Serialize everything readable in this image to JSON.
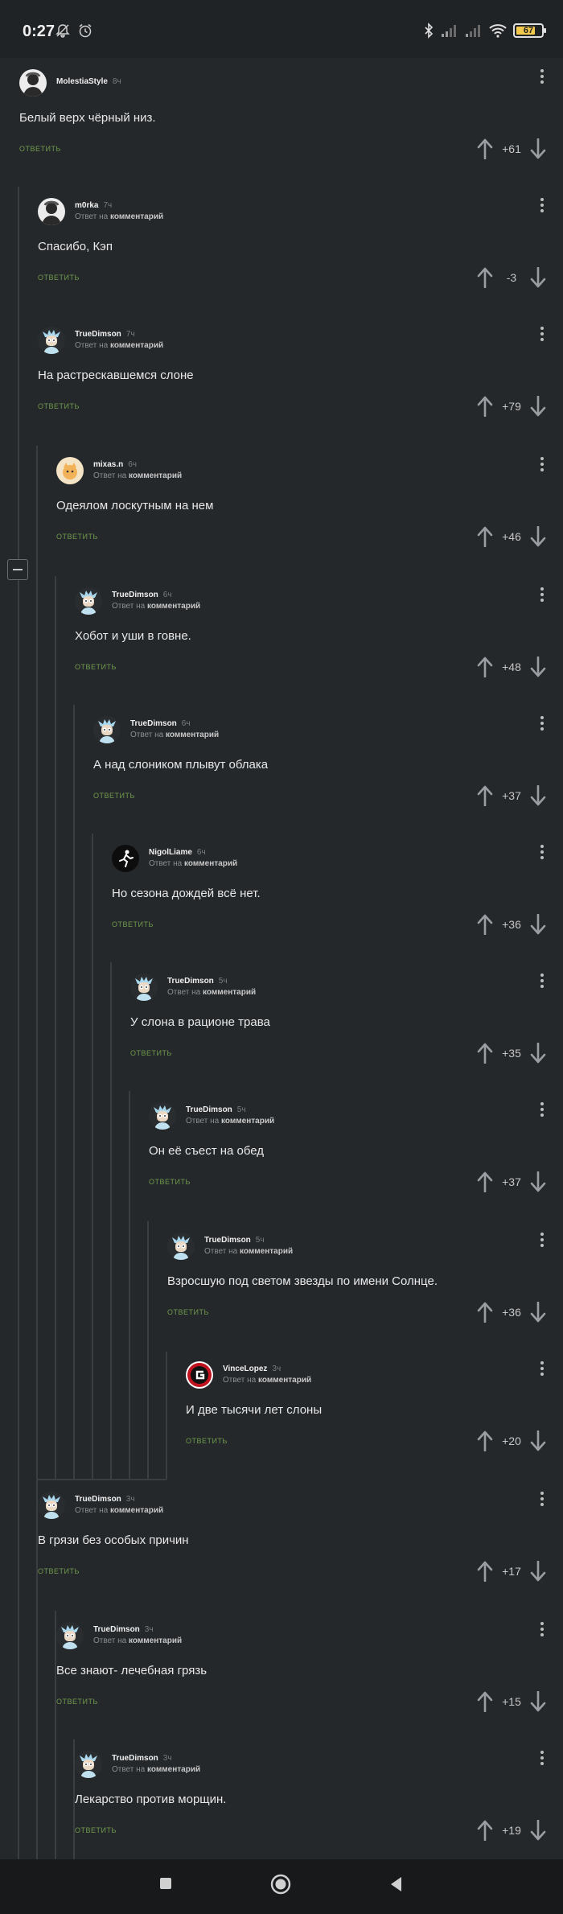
{
  "status_bar": {
    "time": "0:27",
    "battery": "67",
    "battery_color": "#f2c94c"
  },
  "comments": [
    {
      "author": "MolestiaStyle",
      "time": "8ч",
      "reply_to": "",
      "text": "Белый верх чёрный низ.",
      "score": "+61",
      "avatar": "user-avatar"
    },
    {
      "author": "m0rka",
      "time": "7ч",
      "reply_to": "комментарий",
      "text": "Спасибо, Кэп",
      "score": "-3",
      "avatar": "user-avatar"
    },
    {
      "author": "TrueDimson",
      "time": "7ч",
      "reply_to": "комментарий",
      "text": "На растрескавшемся слоне",
      "score": "+79",
      "avatar": "rick-avatar"
    },
    {
      "author": "mixas.n",
      "time": "6ч",
      "reply_to": "комментарий",
      "text": "Одеялом лоскутным на нем",
      "score": "+46",
      "avatar": "cat-avatar"
    },
    {
      "author": "TrueDimson",
      "time": "6ч",
      "reply_to": "комментарий",
      "text": "Хобот и уши в говне.",
      "score": "+48",
      "avatar": "rick-avatar"
    },
    {
      "author": "TrueDimson",
      "time": "6ч",
      "reply_to": "комментарий",
      "text": "А над слоником плывут облака",
      "score": "+37",
      "avatar": "rick-avatar"
    },
    {
      "author": "NigolLiame",
      "time": "6ч",
      "reply_to": "комментарий",
      "text": "Но сезона дождей всё нет.",
      "score": "+36",
      "avatar": "runner-avatar"
    },
    {
      "author": "TrueDimson",
      "time": "5ч",
      "reply_to": "комментарий",
      "text": "У слона в рационе трава",
      "score": "+35",
      "avatar": "rick-avatar"
    },
    {
      "author": "TrueDimson",
      "time": "5ч",
      "reply_to": "комментарий",
      "text": "Он её съест на обед",
      "score": "+37",
      "avatar": "rick-avatar"
    },
    {
      "author": "TrueDimson",
      "time": "5ч",
      "reply_to": "комментарий",
      "text": "Взросшую под светом звезды по имени Солнце.",
      "score": "+36",
      "avatar": "rick-avatar"
    },
    {
      "author": "VinceLopez",
      "time": "3ч",
      "reply_to": "комментарий",
      "text": "И две тысячи лет слоны",
      "score": "+20",
      "avatar": "g-logo-avatar"
    },
    {
      "author": "TrueDimson",
      "time": "3ч",
      "reply_to": "комментарий",
      "text": "В грязи без особых причин",
      "score": "+17",
      "avatar": "rick-avatar"
    },
    {
      "author": "TrueDimson",
      "time": "3ч",
      "reply_to": "комментарий",
      "text": "Все знают- лечебная грязь",
      "score": "+15",
      "avatar": "rick-avatar"
    },
    {
      "author": "TrueDimson",
      "time": "3ч",
      "reply_to": "комментарий",
      "text": "Лекарство против морщин.",
      "score": "+19",
      "avatar": "rick-avatar"
    }
  ],
  "labels": {
    "reply": "ОТВЕТИТЬ",
    "reply_prefix": "Ответ на"
  },
  "colors": {
    "background": "#25282b",
    "accent_green": "#6f9a4c",
    "thread_line": "#3a3e42"
  }
}
